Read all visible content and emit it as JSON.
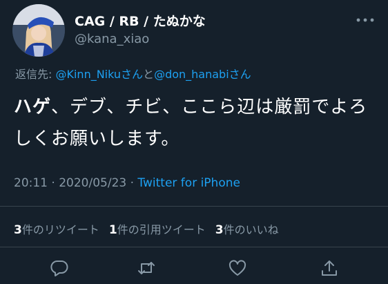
{
  "author": {
    "display_name": "CAG / RB / たぬかな",
    "handle": "@kana_xiao"
  },
  "reply": {
    "prefix": "返信先: ",
    "mention_1": "@Kinn_Nikuさん",
    "connector": "と",
    "mention_2": "@don_hanabiさん"
  },
  "tweet": {
    "bold_part": "ハゲ",
    "text_rest": "、デブ、チビ、ここら辺は厳罰でよろしくお願いします。"
  },
  "meta": {
    "time": "20:11",
    "separator_1": " · ",
    "date": "2020/05/23",
    "separator_2": " · ",
    "source": "Twitter for iPhone"
  },
  "stats": {
    "retweets_count": "3",
    "retweets_label": "件のリツイート",
    "quotes_count": "1",
    "quotes_label": "件の引用ツイート",
    "likes_count": "3",
    "likes_label": "件のいいね"
  },
  "icons": {
    "more": "more-dots-icon",
    "reply": "reply-bubble-icon",
    "retweet": "retweet-icon",
    "like": "heart-icon",
    "share": "share-upload-icon"
  },
  "colors": {
    "background": "#15202b",
    "text": "#ffffff",
    "secondary": "#8899a6",
    "accent": "#1da1f2",
    "divider": "#38444d"
  }
}
